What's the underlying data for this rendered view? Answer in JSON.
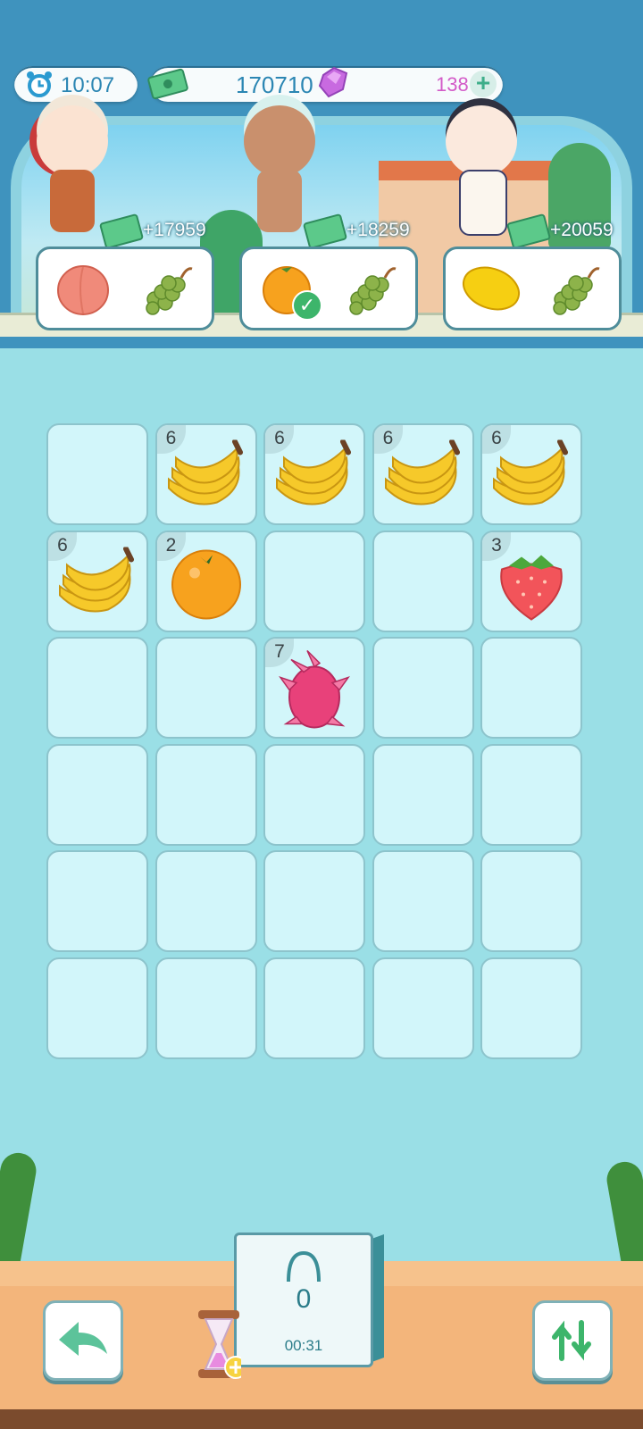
{
  "hud": {
    "time": "10:07",
    "cash": "170710",
    "gems": "138",
    "add_label": "+"
  },
  "customers": [
    {
      "bonus": "+17959",
      "order": [
        "peach",
        "grapes"
      ],
      "fulfilled": [
        false,
        false
      ]
    },
    {
      "bonus": "+18259",
      "order": [
        "orange",
        "grapes"
      ],
      "fulfilled": [
        true,
        false
      ]
    },
    {
      "bonus": "+20059",
      "order": [
        "mango",
        "grapes"
      ],
      "fulfilled": [
        false,
        false
      ]
    }
  ],
  "board": {
    "rows": 6,
    "cols": 5,
    "cells": [
      [
        null,
        {
          "fruit": "banana",
          "count": "6"
        },
        {
          "fruit": "banana",
          "count": "6"
        },
        {
          "fruit": "banana",
          "count": "6"
        },
        {
          "fruit": "banana",
          "count": "6"
        }
      ],
      [
        {
          "fruit": "banana",
          "count": "6"
        },
        {
          "fruit": "orange",
          "count": "2"
        },
        null,
        null,
        {
          "fruit": "strawberry",
          "count": "3"
        }
      ],
      [
        null,
        null,
        {
          "fruit": "dragonfruit",
          "count": "7"
        },
        null,
        null
      ],
      [
        null,
        null,
        null,
        null,
        null
      ],
      [
        null,
        null,
        null,
        null,
        null
      ],
      [
        null,
        null,
        null,
        null,
        null
      ]
    ]
  },
  "bag": {
    "count": "0",
    "timer": "00:31"
  },
  "colors": {
    "sky": "#3f93be",
    "board_bg": "#9adfe6",
    "cell": "#d2f6fa",
    "counter": "#f3b57b"
  }
}
